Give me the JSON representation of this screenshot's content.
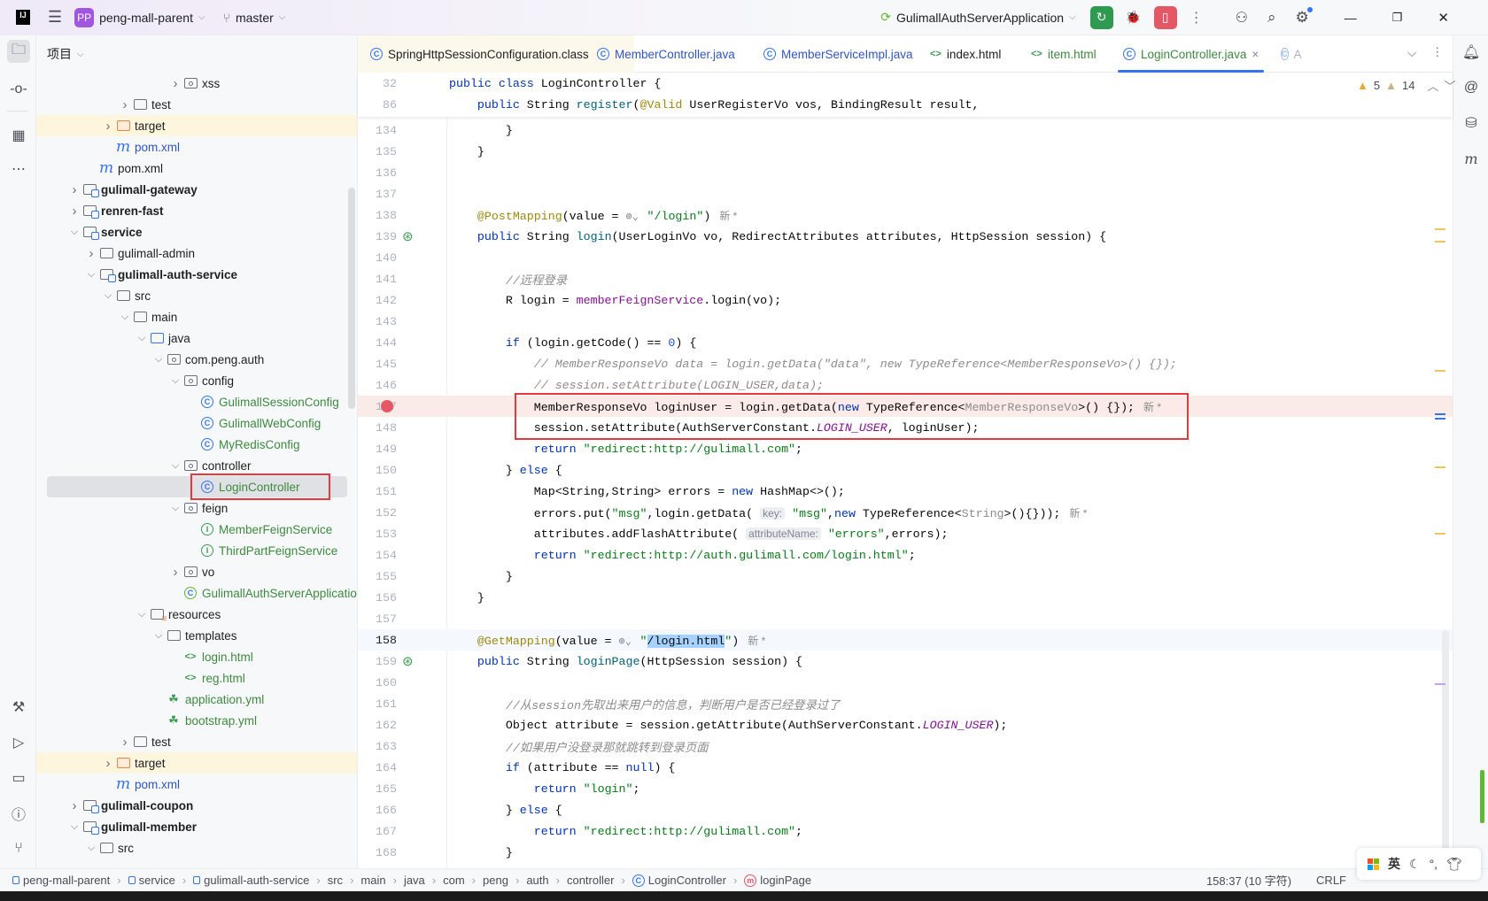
{
  "titlebar": {
    "project_badge": "PP",
    "project_name": "peng-mall-parent",
    "branch": "master",
    "run_config": "GulimallAuthServerApplication",
    "colors": {
      "run_button": "#2e9a4f",
      "profile_button": "#e55765",
      "project_badge": "#a056e0"
    }
  },
  "project_panel": {
    "title": "项目",
    "tree": [
      {
        "depth": 6,
        "chevron": "right",
        "icon": "package-folder",
        "label": "xss"
      },
      {
        "depth": 3,
        "chevron": "right",
        "icon": "folder",
        "label": "test"
      },
      {
        "depth": 2,
        "chevron": "right",
        "icon": "excluded-folder",
        "label": "target",
        "highlight": true
      },
      {
        "depth": 2,
        "chevron": "none",
        "icon": "maven",
        "label": "pom.xml",
        "color": "#2f54c8"
      },
      {
        "depth": 1,
        "chevron": "none",
        "icon": "maven",
        "label": "pom.xml"
      },
      {
        "depth": 0,
        "chevron": "right",
        "icon": "module-folder",
        "label": "gulimall-gateway",
        "bold": true
      },
      {
        "depth": 0,
        "chevron": "right",
        "icon": "module-folder",
        "label": "renren-fast",
        "bold": true
      },
      {
        "depth": 0,
        "chevron": "down",
        "icon": "module-folder",
        "label": "service",
        "bold": true
      },
      {
        "depth": 1,
        "chevron": "right",
        "icon": "folder",
        "label": "gulimall-admin"
      },
      {
        "depth": 1,
        "chevron": "down",
        "icon": "module-folder",
        "label": "gulimall-auth-service",
        "bold": true
      },
      {
        "depth": 2,
        "chevron": "down",
        "icon": "folder",
        "label": "src"
      },
      {
        "depth": 3,
        "chevron": "down",
        "icon": "folder",
        "label": "main"
      },
      {
        "depth": 4,
        "chevron": "down",
        "icon": "source-folder",
        "label": "java"
      },
      {
        "depth": 5,
        "chevron": "down",
        "icon": "package-folder",
        "label": "com.peng.auth"
      },
      {
        "depth": 6,
        "chevron": "down",
        "icon": "package-folder",
        "label": "config"
      },
      {
        "depth": 7,
        "chevron": "none",
        "icon": "class",
        "label": "GulimallSessionConfig",
        "color": "#3d8a3f"
      },
      {
        "depth": 7,
        "chevron": "none",
        "icon": "class",
        "label": "GulimallWebConfig",
        "color": "#3d8a3f"
      },
      {
        "depth": 7,
        "chevron": "none",
        "icon": "class",
        "label": "MyRedisConfig",
        "color": "#3d8a3f"
      },
      {
        "depth": 6,
        "chevron": "down",
        "icon": "package-folder",
        "label": "controller"
      },
      {
        "depth": 7,
        "chevron": "none",
        "icon": "class",
        "label": "LoginController",
        "color": "#3d8a3f",
        "selected": true,
        "annotated": true
      },
      {
        "depth": 6,
        "chevron": "down",
        "icon": "package-folder",
        "label": "feign"
      },
      {
        "depth": 7,
        "chevron": "none",
        "icon": "interface",
        "label": "MemberFeignService",
        "color": "#3d8a3f"
      },
      {
        "depth": 7,
        "chevron": "none",
        "icon": "interface",
        "label": "ThirdPartFeignService",
        "color": "#3d8a3f"
      },
      {
        "depth": 6,
        "chevron": "right",
        "icon": "package-folder",
        "label": "vo"
      },
      {
        "depth": 6,
        "chevron": "none",
        "icon": "spring-boot-class",
        "label": "GulimallAuthServerApplication",
        "color": "#3d8a3f"
      },
      {
        "depth": 4,
        "chevron": "down",
        "icon": "resources-folder",
        "label": "resources"
      },
      {
        "depth": 5,
        "chevron": "down",
        "icon": "folder",
        "label": "templates"
      },
      {
        "depth": 6,
        "chevron": "none",
        "icon": "html",
        "label": "login.html",
        "color": "#3d8a3f"
      },
      {
        "depth": 6,
        "chevron": "none",
        "icon": "html",
        "label": "reg.html",
        "color": "#3d8a3f"
      },
      {
        "depth": 5,
        "chevron": "none",
        "icon": "spring-yml",
        "label": "application.yml",
        "color": "#3d8a3f"
      },
      {
        "depth": 5,
        "chevron": "none",
        "icon": "spring-yml",
        "label": "bootstrap.yml",
        "color": "#3d8a3f"
      },
      {
        "depth": 3,
        "chevron": "right",
        "icon": "folder",
        "label": "test"
      },
      {
        "depth": 2,
        "chevron": "right",
        "icon": "excluded-folder",
        "label": "target",
        "highlight": true
      },
      {
        "depth": 2,
        "chevron": "none",
        "icon": "maven",
        "label": "pom.xml",
        "color": "#2f54c8"
      },
      {
        "depth": 0,
        "chevron": "right",
        "icon": "module-folder",
        "label": "gulimall-coupon",
        "bold": true
      },
      {
        "depth": 0,
        "chevron": "down",
        "icon": "module-folder",
        "label": "gulimall-member",
        "bold": true
      },
      {
        "depth": 1,
        "chevron": "down",
        "icon": "folder",
        "label": "src"
      }
    ]
  },
  "tabs": [
    {
      "label": "SpringHttpSessionConfiguration.class",
      "icon": "class",
      "color": "#1e1f22",
      "pinned_bg": true
    },
    {
      "label": "MemberController.java",
      "icon": "class",
      "color": "#2f54c8"
    },
    {
      "label": "MemberServiceImpl.java",
      "icon": "class",
      "color": "#2f54c8"
    },
    {
      "label": "index.html",
      "icon": "html",
      "color": "#1e1f22"
    },
    {
      "label": "item.html",
      "icon": "html",
      "color": "#3d8a3f"
    },
    {
      "label": "LoginController.java",
      "icon": "class",
      "color": "#3d8a3f",
      "active": true,
      "close": "×"
    },
    {
      "label": "A",
      "icon": "class",
      "color": "#aeb3c2"
    }
  ],
  "inspections": {
    "warnings": "5",
    "weak_warnings": "14"
  },
  "sticky_lines": [
    {
      "n": "32",
      "tokens": [
        [
          "kw",
          "public class"
        ],
        [
          "",
          " LoginController {"
        ]
      ]
    },
    {
      "n": "86",
      "tokens": [
        [
          "",
          "    "
        ],
        [
          "kw",
          "public"
        ],
        [
          "",
          " String "
        ],
        [
          "fn",
          "register"
        ],
        [
          "",
          "("
        ],
        [
          "ann",
          "@Valid"
        ],
        [
          "",
          " UserRegisterVo vos, BindingResult result,"
        ]
      ]
    }
  ],
  "code_lines": [
    {
      "n": "134",
      "tokens": [
        [
          "",
          "        }"
        ]
      ]
    },
    {
      "n": "135",
      "tokens": [
        [
          "",
          "    }"
        ]
      ]
    },
    {
      "n": "136",
      "tokens": []
    },
    {
      "n": "137",
      "tokens": []
    },
    {
      "n": "138",
      "tokens": [
        [
          "",
          "    "
        ],
        [
          "ann",
          "@PostMapping"
        ],
        [
          "",
          "(value = "
        ],
        [
          "globe",
          ""
        ],
        [
          "str",
          "\"/login\""
        ],
        [
          "",
          ")"
        ],
        [
          "new",
          "新 *"
        ]
      ]
    },
    {
      "n": "139",
      "gutter": "web-endpoint",
      "tokens": [
        [
          "",
          "    "
        ],
        [
          "kw",
          "public"
        ],
        [
          "",
          " String "
        ],
        [
          "fn",
          "login"
        ],
        [
          "",
          "(UserLoginVo vo, RedirectAttributes attributes, HttpSession session) {"
        ]
      ]
    },
    {
      "n": "140",
      "tokens": []
    },
    {
      "n": "141",
      "tokens": [
        [
          "",
          "        "
        ],
        [
          "cm",
          "//远程登录"
        ]
      ]
    },
    {
      "n": "142",
      "tokens": [
        [
          "",
          "        R login = "
        ],
        [
          "fld",
          "memberFeignService"
        ],
        [
          "",
          ".login(vo);"
        ]
      ]
    },
    {
      "n": "143",
      "tokens": []
    },
    {
      "n": "144",
      "tokens": [
        [
          "",
          "        "
        ],
        [
          "kw",
          "if"
        ],
        [
          "",
          " (login.getCode() == "
        ],
        [
          "num",
          "0"
        ],
        [
          "",
          ") {"
        ]
      ]
    },
    {
      "n": "145",
      "tokens": [
        [
          "",
          "            "
        ],
        [
          "cm",
          "// MemberResponseVo data = login.getData(\"data\", new TypeReference<MemberResponseVo>() {});"
        ]
      ]
    },
    {
      "n": "146",
      "tokens": [
        [
          "",
          "            "
        ],
        [
          "cm",
          "// session.setAttribute(LOGIN_USER,data);"
        ]
      ]
    },
    {
      "n": "147",
      "breakpoint": true,
      "tokens": [
        [
          "",
          "            MemberResponseVo loginUser = login.getData("
        ],
        [
          "kw",
          "new"
        ],
        [
          "",
          " TypeReference<"
        ],
        [
          "gray",
          "MemberResponseVo"
        ],
        [
          "",
          ">() {});"
        ],
        [
          "new",
          "新 *"
        ]
      ]
    },
    {
      "n": "148",
      "tokens": [
        [
          "",
          "            session.setAttribute(AuthServerConstant."
        ],
        [
          "fldi",
          "LOGIN_USER"
        ],
        [
          "",
          ", loginUser);"
        ]
      ]
    },
    {
      "n": "149",
      "tokens": [
        [
          "",
          "            "
        ],
        [
          "kw",
          "return"
        ],
        [
          "",
          " "
        ],
        [
          "str",
          "\"redirect:http://gulimall.com\""
        ],
        [
          "",
          ";"
        ]
      ]
    },
    {
      "n": "150",
      "tokens": [
        [
          "",
          "        } "
        ],
        [
          "kw",
          "else"
        ],
        [
          "",
          " {"
        ]
      ]
    },
    {
      "n": "151",
      "tokens": [
        [
          "",
          "            Map<String,String> errors = "
        ],
        [
          "kw",
          "new"
        ],
        [
          "",
          " HashMap<>();"
        ]
      ]
    },
    {
      "n": "152",
      "tokens": [
        [
          "",
          "            errors.put("
        ],
        [
          "str",
          "\"msg\""
        ],
        [
          "",
          ",login.getData( "
        ],
        [
          "hint",
          "key:"
        ],
        [
          "",
          " "
        ],
        [
          "str",
          "\"msg\""
        ],
        [
          "",
          ","
        ],
        [
          "kw",
          "new"
        ],
        [
          "",
          " TypeReference<"
        ],
        [
          "gray",
          "String"
        ],
        [
          "",
          ">(){}));"
        ],
        [
          "new",
          "新 *"
        ]
      ]
    },
    {
      "n": "153",
      "tokens": [
        [
          "",
          "            attributes.addFlashAttribute( "
        ],
        [
          "hint",
          "attributeName:"
        ],
        [
          "",
          " "
        ],
        [
          "str",
          "\"errors\""
        ],
        [
          "",
          ",errors);"
        ]
      ]
    },
    {
      "n": "154",
      "tokens": [
        [
          "",
          "            "
        ],
        [
          "kw",
          "return"
        ],
        [
          "",
          " "
        ],
        [
          "str",
          "\"redirect:http://auth.gulimall.com/login.html\""
        ],
        [
          "",
          ";"
        ]
      ]
    },
    {
      "n": "155",
      "tokens": [
        [
          "",
          "        }"
        ]
      ]
    },
    {
      "n": "156",
      "tokens": [
        [
          "",
          "    }"
        ]
      ]
    },
    {
      "n": "157",
      "tokens": []
    },
    {
      "n": "158",
      "current": true,
      "tokens": [
        [
          "",
          "    "
        ],
        [
          "ann",
          "@GetMapping"
        ],
        [
          "",
          "(value = "
        ],
        [
          "globe",
          ""
        ],
        [
          "str",
          "\""
        ],
        [
          "sel",
          "/login.html"
        ],
        [
          "str",
          "\""
        ],
        [
          "",
          ")"
        ],
        [
          "new",
          "新 *"
        ]
      ]
    },
    {
      "n": "159",
      "gutter": "web-endpoint",
      "tokens": [
        [
          "",
          "    "
        ],
        [
          "kw",
          "public"
        ],
        [
          "",
          " String "
        ],
        [
          "fn",
          "loginPage"
        ],
        [
          "",
          "(HttpSession session) {"
        ]
      ]
    },
    {
      "n": "160",
      "tokens": []
    },
    {
      "n": "161",
      "tokens": [
        [
          "",
          "        "
        ],
        [
          "cm",
          "//从session先取出来用户的信息，判断用户是否已经登录过了"
        ]
      ]
    },
    {
      "n": "162",
      "tokens": [
        [
          "",
          "        Object attribute = session.getAttribute(AuthServerConstant."
        ],
        [
          "fldi",
          "LOGIN_USER"
        ],
        [
          "",
          ");"
        ]
      ]
    },
    {
      "n": "163",
      "tokens": [
        [
          "",
          "        "
        ],
        [
          "cm",
          "//如果用户没登录那就跳转到登录页面"
        ]
      ]
    },
    {
      "n": "164",
      "tokens": [
        [
          "",
          "        "
        ],
        [
          "kw",
          "if"
        ],
        [
          "",
          " (attribute == "
        ],
        [
          "kw",
          "null"
        ],
        [
          "",
          ") {"
        ]
      ]
    },
    {
      "n": "165",
      "tokens": [
        [
          "",
          "            "
        ],
        [
          "kw",
          "return"
        ],
        [
          "",
          " "
        ],
        [
          "str",
          "\"login\""
        ],
        [
          "",
          ";"
        ]
      ]
    },
    {
      "n": "166",
      "tokens": [
        [
          "",
          "        } "
        ],
        [
          "kw",
          "else"
        ],
        [
          "",
          " {"
        ]
      ]
    },
    {
      "n": "167",
      "tokens": [
        [
          "",
          "            "
        ],
        [
          "kw",
          "return"
        ],
        [
          "",
          " "
        ],
        [
          "str",
          "\"redirect:http://gulimall.com\""
        ],
        [
          "",
          ";"
        ]
      ]
    },
    {
      "n": "168",
      "tokens": [
        [
          "",
          "        }"
        ]
      ]
    }
  ],
  "statusbar": {
    "breadcrumbs": [
      {
        "label": "peng-mall-parent",
        "icon": "module"
      },
      {
        "label": "service",
        "icon": "module"
      },
      {
        "label": "gulimall-auth-service",
        "icon": "module"
      },
      {
        "label": "src"
      },
      {
        "label": "main"
      },
      {
        "label": "java"
      },
      {
        "label": "com"
      },
      {
        "label": "peng"
      },
      {
        "label": "auth"
      },
      {
        "label": "controller"
      },
      {
        "label": "LoginController",
        "icon": "class"
      },
      {
        "label": "loginPage",
        "icon": "method"
      }
    ],
    "position": "158:37 (10 字符)",
    "line_ending": "CRLF"
  },
  "ime": {
    "mode": "英"
  },
  "highlight_color": "#e8383d"
}
